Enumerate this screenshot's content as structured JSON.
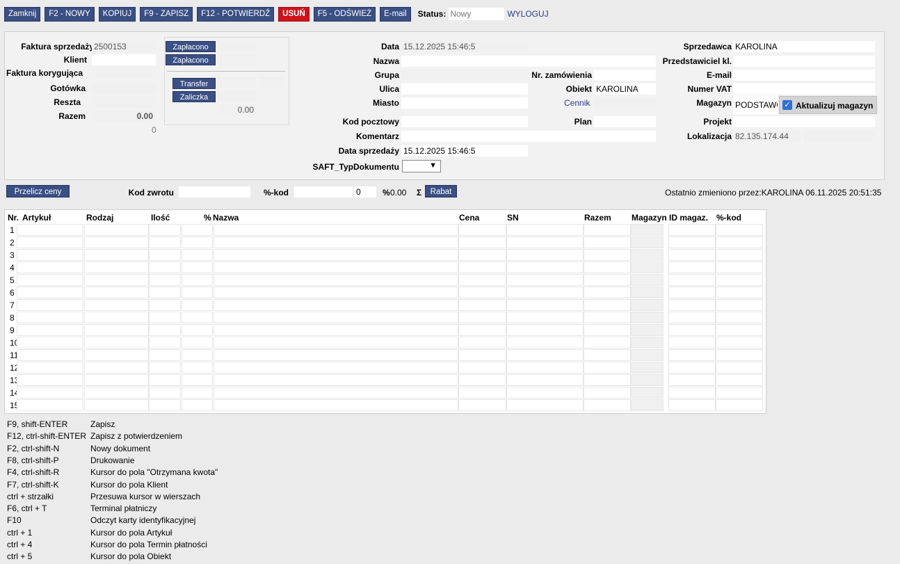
{
  "toolbar": {
    "buttons": [
      "Zamknij",
      "F2 - NOWY",
      "KOPIUJ",
      "F9 - ZAPISZ",
      "F12 - POTWIERDŹ",
      "USUŃ",
      "F5 - ODŚWIEŻ",
      "E-mail"
    ],
    "status_label": "Status:",
    "status_value": "Nowy",
    "logout": "WYLOGUJ"
  },
  "left": {
    "faktura_label": "Faktura sprzedaży",
    "faktura_value": "2500153",
    "klient_label": "Klient",
    "korygujaca_label": "Faktura korygująca",
    "gotowka_label": "Gotówka",
    "reszta_label": "Reszta",
    "razem_label": "Razem",
    "razem_value": "0.00",
    "zero": "0"
  },
  "pay": {
    "zaplacono1": "Zapłacono",
    "zaplacono2": "Zapłacono",
    "transfer": "Transfer",
    "zaliczka": "Zaliczka",
    "total": "0.00"
  },
  "mid": {
    "data_label": "Data",
    "data_value": "15.12.2025 15:46:5",
    "nazwa_label": "Nazwa",
    "grupa_label": "Grupa",
    "ulica_label": "Ulica",
    "miasto_label": "Miasto",
    "kod_label": "Kod pocztowy",
    "komentarz_label": "Komentarz",
    "data_sprz_label": "Data sprzedaży",
    "data_sprz_value": "15.12.2025 15:46:5",
    "saft_label": "SAFT_TypDokumentu",
    "nr_zam_label": "Nr. zamówienia",
    "obiekt_label": "Obiekt",
    "obiekt_value": "KAROLINA",
    "cennik": "Cennik",
    "plan_label": "Plan"
  },
  "right": {
    "sprzedawca_label": "Sprzedawca",
    "sprzedawca_value": "KAROLINA",
    "przedst_label": "Przedstawiciel kl.",
    "email_label": "E-mail",
    "vat_label": "Numer VAT",
    "magazyn_label": "Magazyn",
    "magazyn_value": "PODSTAWO",
    "aktualizuj": "Aktualizuj magazyn",
    "projekt_label": "Projekt",
    "lokal_label": "Lokalizacja",
    "lokal_value": "82.135.174.44"
  },
  "row2": {
    "przelicz": "Przelicz ceny",
    "kod_zwrotu": "Kod zwrotu",
    "pct_kod": "%-kod",
    "zero": "0",
    "pct": "%",
    "pct_val": "0.00",
    "sigma": "Σ",
    "rabat": "Rabat",
    "modified": "Ostatnio zmieniono przez:KAROLINA 06.11.2025 20:51:35"
  },
  "table": {
    "headers": [
      "Nr.",
      "Artykuł",
      "Rodzaj",
      "Ilość",
      "%",
      "Nazwa",
      "Cena",
      "SN",
      "Razem",
      "Magazyn",
      "ID magaz.",
      "%-kod"
    ],
    "rows": [
      "1",
      "2",
      "3",
      "4",
      "5",
      "6",
      "7",
      "8",
      "9",
      "10",
      "11",
      "12",
      "13",
      "14",
      "15"
    ]
  },
  "shortcuts": [
    [
      "F9, shift-ENTER",
      "Zapisz"
    ],
    [
      "F12, ctrl-shift-ENTER",
      "Zapisz z potwierdzeniem"
    ],
    [
      "F2, ctrl-shift-N",
      "Nowy dokument"
    ],
    [
      "F8, ctrl-shift-P",
      "Drukowanie"
    ],
    [
      "F4, ctrl-shift-R",
      "Kursor do pola \"Otrzymana kwota\""
    ],
    [
      "F7, ctrl-shift-K",
      "Kursor do pola Klient"
    ],
    [
      "ctrl + strzałki",
      "Przesuwa kursor w wierszach"
    ],
    [
      "F6, ctrl + T",
      "Terminal płatniczy"
    ],
    [
      "F10",
      "Odczyt karty identyfikacyjnej"
    ],
    [
      "ctrl + 1",
      "Kursor do pola Artykuł"
    ],
    [
      "ctrl + 4",
      "Kursor do pola Termin płatności"
    ],
    [
      "ctrl + 5",
      "Kursor do pola Obiekt"
    ]
  ]
}
